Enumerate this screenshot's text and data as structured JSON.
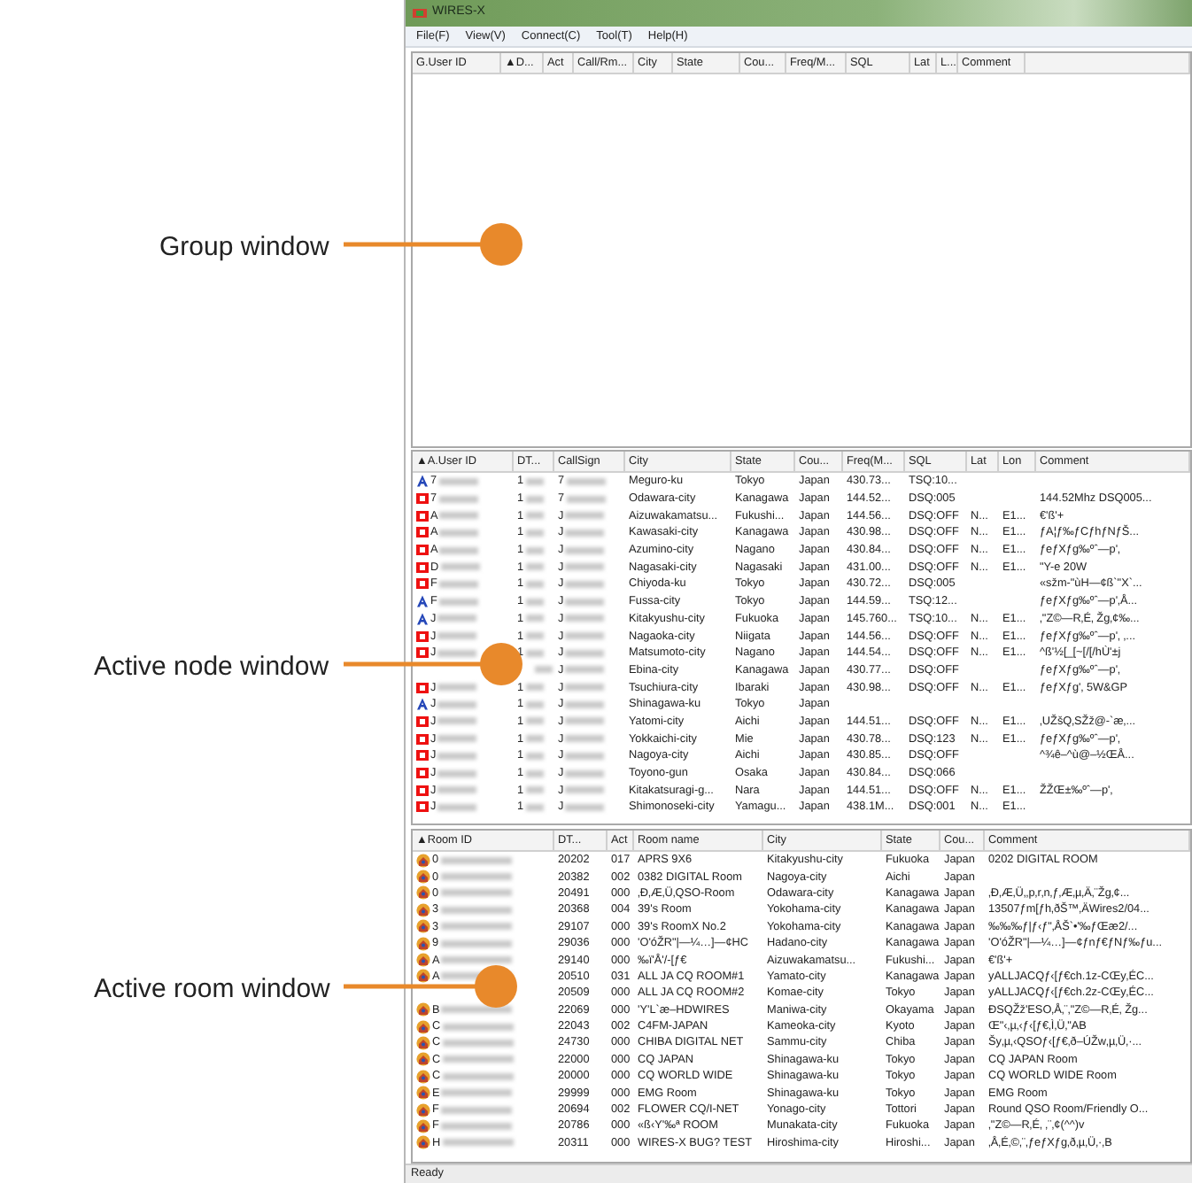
{
  "callouts": [
    {
      "label": "Group window"
    },
    {
      "label": "Active node window"
    },
    {
      "label": "Active room window"
    }
  ],
  "window": {
    "title": "WIRES-X"
  },
  "menu": [
    "File(F)",
    "View(V)",
    "Connect(C)",
    "Tool(T)",
    "Help(H)"
  ],
  "group_window": {
    "columns": [
      "G.User ID",
      "▲D...",
      "Act",
      "Call/Rm...",
      "City",
      "State",
      "Cou...",
      "Freq/M...",
      "SQL",
      "Lat",
      "L...",
      "Comment"
    ]
  },
  "active_node_window": {
    "columns": [
      "▲A.User ID",
      "DT...",
      "CallSign",
      "City",
      "State",
      "Cou...",
      "Freq(M...",
      "SQL",
      "Lat",
      "Lon",
      "Comment"
    ],
    "rows": [
      {
        "kind": "analog",
        "id": "7",
        "dt": "1",
        "callsign": "7",
        "city": "Meguro-ku",
        "state": "Tokyo",
        "country": "Japan",
        "freq": "430.73...",
        "sql": "TSQ:10..."
      },
      {
        "kind": "digital",
        "id": "7",
        "dt": "1",
        "callsign": "7",
        "city": "Odawara-city",
        "state": "Kanagawa",
        "country": "Japan",
        "freq": "144.52...",
        "sql": "DSQ:005",
        "comment": "144.52Mhz DSQ005..."
      },
      {
        "kind": "digital",
        "id": "A",
        "dt": "1",
        "callsign": "J",
        "city": "Aizuwakamatsu...",
        "state": "Fukushi...",
        "country": "Japan",
        "freq": "144.56...",
        "sql": "DSQ:OFF",
        "lat": "N...",
        "lon": "E1...",
        "comment": "€'ß'+"
      },
      {
        "kind": "digital",
        "id": "A",
        "dt": "1",
        "callsign": "J",
        "city": "Kawasaki-city",
        "state": "Kanagawa",
        "country": "Japan",
        "freq": "430.98...",
        "sql": "DSQ:OFF",
        "lat": "N...",
        "lon": "E1...",
        "comment": "ƒA¦ƒ‰ƒCƒhƒNƒŠ..."
      },
      {
        "kind": "digital",
        "id": "A",
        "dt": "1",
        "callsign": "J",
        "city": "Azumino-city",
        "state": "Nagano",
        "country": "Japan",
        "freq": "430.84...",
        "sql": "DSQ:OFF",
        "lat": "N...",
        "lon": "E1...",
        "comment": "ƒeƒXƒg‰ºˆ—p'‚"
      },
      {
        "kind": "digital",
        "id": "D",
        "dt": "1",
        "callsign": "J",
        "city": "Nagasaki-city",
        "state": "Nagasaki",
        "country": "Japan",
        "freq": "431.00...",
        "sql": "DSQ:OFF",
        "lat": "N...",
        "lon": "E1...",
        "comment": "\"Y-e 20W"
      },
      {
        "kind": "digital",
        "id": "F",
        "dt": "1",
        "callsign": "J",
        "city": "Chiyoda-ku",
        "state": "Tokyo",
        "country": "Japan",
        "freq": "430.72...",
        "sql": "DSQ:005",
        "comment": "«sžm-\"ùH—¢ß`\"X`..."
      },
      {
        "kind": "analog",
        "id": "F",
        "dt": "1",
        "callsign": "J",
        "city": "Fussa-city",
        "state": "Tokyo",
        "country": "Japan",
        "freq": "144.59...",
        "sql": "TSQ:12...",
        "comment": "ƒeƒXƒg‰ºˆ—p'‚Å..."
      },
      {
        "kind": "analog",
        "id": "J",
        "dt": "1",
        "callsign": "J",
        "city": "Kitakyushu-city",
        "state": "Fukuoka",
        "country": "Japan",
        "freq": "145.760...",
        "sql": "TSQ:10...",
        "lat": "N...",
        "lon": "E1...",
        "comment": "‚\"Z©—R‚É‚ Žg‚¢‰..."
      },
      {
        "kind": "digital",
        "id": "J",
        "dt": "1",
        "callsign": "J",
        "city": "Nagaoka-city",
        "state": "Niigata",
        "country": "Japan",
        "freq": "144.56...",
        "sql": "DSQ:OFF",
        "lat": "N...",
        "lon": "E1...",
        "comment": "ƒeƒXƒg‰ºˆ—p'‚ ‚..."
      },
      {
        "kind": "digital",
        "id": "J",
        "dt": "1",
        "callsign": "J",
        "city": "Matsumoto-city",
        "state": "Nagano",
        "country": "Japan",
        "freq": "144.54...",
        "sql": "DSQ:OFF",
        "lat": "N...",
        "lon": "E1...",
        "comment": "^ß'½[_[~[/[/hÙ'±j"
      },
      {
        "callsign": "J",
        "city": "Ebina-city",
        "state": "Kanagawa",
        "country": "Japan",
        "freq": "430.77...",
        "sql": "DSQ:OFF",
        "comment": "ƒeƒXƒg‰ºˆ—p'‚"
      },
      {
        "kind": "digital",
        "id": "J",
        "dt": "1",
        "callsign": "J",
        "city": "Tsuchiura-city",
        "state": "Ibaraki",
        "country": "Japan",
        "freq": "430.98...",
        "sql": "DSQ:OFF",
        "lat": "N...",
        "lon": "E1...",
        "comment": "ƒeƒXƒg'‚ 5W&GP"
      },
      {
        "kind": "analog",
        "id": "J",
        "dt": "1",
        "callsign": "J",
        "city": "Shinagawa-ku",
        "state": "Tokyo",
        "country": "Japan"
      },
      {
        "kind": "digital",
        "id": "J",
        "dt": "1",
        "callsign": "J",
        "city": "Yatomi-city",
        "state": "Aichi",
        "country": "Japan",
        "freq": "144.51...",
        "sql": "DSQ:OFF",
        "lat": "N...",
        "lon": "E1...",
        "comment": "‚UŽšQ‚SŽž@-`æ‚..."
      },
      {
        "kind": "digital",
        "id": "J",
        "dt": "1",
        "callsign": "J",
        "city": "Yokkaichi-city",
        "state": "Mie",
        "country": "Japan",
        "freq": "430.78...",
        "sql": "DSQ:123",
        "lat": "N...",
        "lon": "E1...",
        "comment": "ƒeƒXƒg‰ºˆ—p'‚"
      },
      {
        "kind": "digital",
        "id": "J",
        "dt": "1",
        "callsign": "J",
        "city": "Nagoya-city",
        "state": "Aichi",
        "country": "Japan",
        "freq": "430.85...",
        "sql": "DSQ:OFF",
        "comment": "^¾ê–^ù@–½ŒÅ..."
      },
      {
        "kind": "digital",
        "id": "J",
        "dt": "1",
        "callsign": "J",
        "city": "Toyono-gun",
        "state": "Osaka",
        "country": "Japan",
        "freq": "430.84...",
        "sql": "DSQ:066"
      },
      {
        "kind": "digital",
        "id": "J",
        "dt": "1",
        "callsign": "J",
        "city": "Kitakatsuragi-g...",
        "state": "Nara",
        "country": "Japan",
        "freq": "144.51...",
        "sql": "DSQ:OFF",
        "lat": "N...",
        "lon": "E1...",
        "comment": "ŽŽŒ±‰ºˆ—p'‚"
      },
      {
        "kind": "digital",
        "id": "J",
        "dt": "1",
        "callsign": "J",
        "city": "Shimonoseki-city",
        "state": "Yamagu...",
        "country": "Japan",
        "freq": "438.1M...",
        "sql": "DSQ:001",
        "lat": "N...",
        "lon": "E1..."
      }
    ]
  },
  "active_room_window": {
    "columns": [
      "▲Room ID",
      "DT...",
      "Act",
      "Room name",
      "City",
      "State",
      "Cou...",
      "Comment"
    ],
    "rows": [
      {
        "icon": true,
        "id": "0",
        "dt": "20202",
        "act": "017",
        "name": "APRS 9X6",
        "city": "Kitakyushu-city",
        "state": "Fukuoka",
        "country": "Japan",
        "comment": "0202 DIGITAL ROOM"
      },
      {
        "icon": true,
        "id": "0",
        "dt": "20382",
        "act": "002",
        "name": "0382 DIGITAL Room",
        "city": "Nagoya-city",
        "state": "Aichi",
        "country": "Japan"
      },
      {
        "icon": true,
        "id": "0",
        "dt": "20491",
        "act": "000",
        "name": "‚Ð‚Æ‚Ü‚QSO-Room",
        "city": "Odawara-city",
        "state": "Kanagawa",
        "country": "Japan",
        "comment": "‚Ð‚Æ‚Ü‚‚p‚r‚n‚ƒ‚Æ‚µ‚Ä‚¨Žg‚¢..."
      },
      {
        "icon": true,
        "id": "3",
        "dt": "20368",
        "act": "004",
        "name": "39's Room",
        "city": "Yokohama-city",
        "state": "Kanagawa",
        "country": "Japan",
        "comment": "13507ƒm[ƒh‚ðŠ™‚ÄWires2/04..."
      },
      {
        "icon": true,
        "id": "3",
        "dt": "29107",
        "act": "000",
        "name": "39's RoomX No.2",
        "city": "Yokohama-city",
        "state": "Kanagawa",
        "country": "Japan",
        "comment": "‰‰‰ƒ|ƒ‹ƒ\"‚ÅŠ`•'‰ƒŒæ2/..."
      },
      {
        "icon": true,
        "id": "9",
        "dt": "29036",
        "act": "000",
        "name": "'O'óŽR\"|—¼…]—¢HC",
        "city": "Hadano-city",
        "state": "Kanagawa",
        "country": "Japan",
        "comment": "'O'óŽR\"|—¼…]—¢ƒnƒ€ƒNƒ‰ƒu..."
      },
      {
        "icon": true,
        "id": "A",
        "dt": "29140",
        "act": "000",
        "name": "‰ï'Å'/-[ƒ€",
        "city": "Aizuwakamatsu...",
        "state": "Fukushi...",
        "country": "Japan",
        "comment": "€'ß'+"
      },
      {
        "icon": true,
        "id": "A",
        "dt": "20510",
        "act": "031",
        "name": "ALL JA CQ ROOM#1",
        "city": "Yamato-city",
        "state": "Kanagawa",
        "country": "Japan",
        "comment": "yALLJACQƒ‹[ƒ€ch.1z-CŒy‚ÉC..."
      },
      {
        "icon": false,
        "dt": "20509",
        "act": "000",
        "name": "ALL JA CQ ROOM#2",
        "city": "Komae-city",
        "state": "Tokyo",
        "country": "Japan",
        "comment": "yALLJACQƒ‹[ƒ€ch.2z-CŒy‚ÉC..."
      },
      {
        "icon": true,
        "id": "B",
        "dt": "22069",
        "act": "000",
        "name": "'Y'L`æ–HDWIRES",
        "city": "Maniwa-city",
        "state": "Okayama",
        "country": "Japan",
        "comment": "ÐSQŽž'ESO‚Å‚¨‚\"Z©—R‚É‚ Žg..."
      },
      {
        "icon": true,
        "id": "C",
        "dt": "22043",
        "act": "002",
        "name": "C4FM-JAPAN",
        "city": "Kameoka-city",
        "state": "Kyoto",
        "country": "Japan",
        "comment": "Œ\"‹‚µ‚‹ƒ‹[ƒ€‚Ì‚Ü‚\"AB"
      },
      {
        "icon": true,
        "id": "C",
        "dt": "24730",
        "act": "000",
        "name": "CHIBA DIGITAL NET",
        "city": "Sammu-city",
        "state": "Chiba",
        "country": "Japan",
        "comment": "Šy‚µ‚‹QSOƒ‹[ƒ€‚ð–ÚŽw‚µ‚Ü‚·..."
      },
      {
        "icon": true,
        "id": "C",
        "dt": "22000",
        "act": "000",
        "name": "CQ JAPAN",
        "city": "Shinagawa-ku",
        "state": "Tokyo",
        "country": "Japan",
        "comment": "CQ JAPAN Room"
      },
      {
        "icon": true,
        "id": "C",
        "dt": "20000",
        "act": "000",
        "name": "CQ WORLD WIDE",
        "city": "Shinagawa-ku",
        "state": "Tokyo",
        "country": "Japan",
        "comment": "CQ WORLD WIDE Room"
      },
      {
        "icon": true,
        "id": "E",
        "dt": "29999",
        "act": "000",
        "name": "EMG Room",
        "city": "Shinagawa-ku",
        "state": "Tokyo",
        "country": "Japan",
        "comment": "EMG Room"
      },
      {
        "icon": true,
        "id": "F",
        "dt": "20694",
        "act": "002",
        "name": "FLOWER CQ/I-NET",
        "city": "Yonago-city",
        "state": "Tottori",
        "country": "Japan",
        "comment": "Round QSO Room/Friendly O..."
      },
      {
        "icon": true,
        "id": "F",
        "dt": "20786",
        "act": "000",
        "name": "«ß‹Y'‰ª ROOM",
        "city": "Munakata-city",
        "state": "Fukuoka",
        "country": "Japan",
        "comment": "‚\"Z©—R‚É‚ ‚¨‚¢(^^)v"
      },
      {
        "icon": true,
        "id": "H",
        "dt": "20311",
        "act": "000",
        "name": "WIRES-X BUG? TEST",
        "city": "Hiroshima-city",
        "state": "Hiroshi...",
        "country": "Japan",
        "comment": "‚Å‚É‚©‚¨‚ƒeƒXƒg‚ð‚µ‚Ü‚·‚B"
      }
    ]
  },
  "status_bar": "Ready"
}
